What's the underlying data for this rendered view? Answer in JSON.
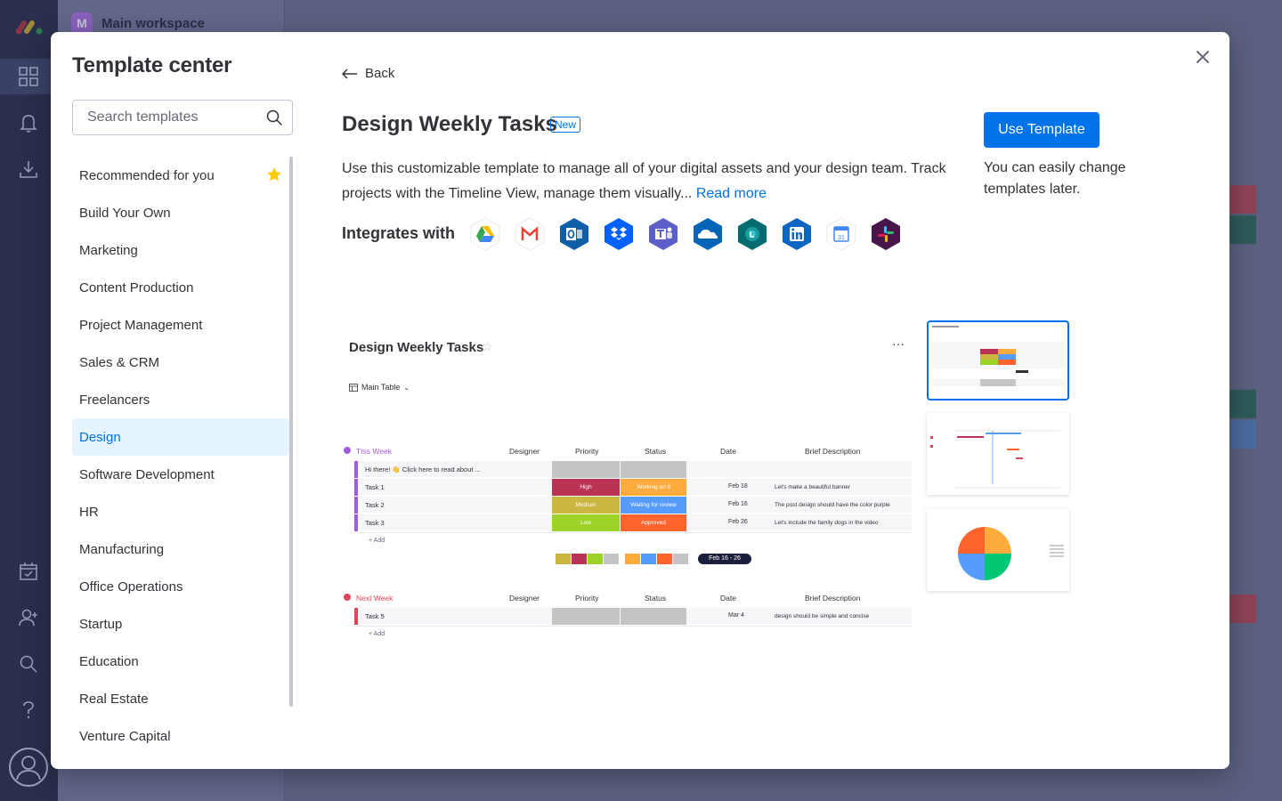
{
  "background": {
    "workspace_initial": "M",
    "workspace_name": "Main workspace"
  },
  "modal": {
    "title": "Template center",
    "search": {
      "placeholder": "Search templates"
    },
    "categories": [
      {
        "label": "Recommended for you",
        "starred": true
      },
      {
        "label": "Build Your Own"
      },
      {
        "label": "Marketing"
      },
      {
        "label": "Content Production"
      },
      {
        "label": "Project Management"
      },
      {
        "label": "Sales & CRM"
      },
      {
        "label": "Freelancers"
      },
      {
        "label": "Design",
        "active": true
      },
      {
        "label": "Software Development"
      },
      {
        "label": "HR"
      },
      {
        "label": "Manufacturing"
      },
      {
        "label": "Office Operations"
      },
      {
        "label": "Startup"
      },
      {
        "label": "Education"
      },
      {
        "label": "Real Estate"
      },
      {
        "label": "Venture Capital"
      }
    ]
  },
  "template": {
    "back_label": "Back",
    "title": "Design Weekly Tasks",
    "badge": "New",
    "description": "Use this customizable template to manage all of your digital assets and your design team. Track projects with the Timeline View, manage them visually...",
    "read_more": "Read more",
    "integrates_label": "Integrates with",
    "integrations": [
      "google-drive-icon",
      "gmail-icon",
      "outlook-icon",
      "dropbox-icon",
      "teams-icon",
      "onedrive-icon",
      "sharepoint-icon",
      "linkedin-icon",
      "google-calendar-icon",
      "slack-icon"
    ],
    "use_button": "Use Template",
    "change_note": "You can easily change templates later."
  },
  "preview": {
    "board_title": "Design Weekly Tasks",
    "table_tab": "Main Table",
    "columns": {
      "designer": "Designer",
      "priority": "Priority",
      "status": "Status",
      "date": "Date",
      "brief": "Brief Description"
    },
    "groups": [
      {
        "name": "This Week",
        "color": "#a25ddc",
        "rows": [
          {
            "item": "Hi there! 👋 Click here to read about ...",
            "priority": "",
            "status": "",
            "date": "",
            "brief": ""
          },
          {
            "item": "Task 1",
            "priority": "High",
            "status": "Working on it",
            "date": "Feb 18",
            "brief": "Let's make a beautiful banner"
          },
          {
            "item": "Task 2",
            "priority": "Medium",
            "status": "Waiting for review",
            "date": "Feb 16",
            "brief": "The post design should have the color purple"
          },
          {
            "item": "Task 3",
            "priority": "Low",
            "status": "Approved",
            "date": "Feb 26",
            "brief": "Let's include the family dogs in the video"
          }
        ],
        "add_label": "+ Add",
        "timeline_summary": "Feb 16 - 26"
      },
      {
        "name": "Next Week",
        "color": "#e2445c",
        "rows": [
          {
            "item": "Task 5",
            "priority": "",
            "status": "",
            "date": "Mar 4",
            "brief": "design should be simple and concise"
          }
        ],
        "add_label": "+ Add"
      }
    ],
    "colors": {
      "high": "#bb3354",
      "medium": "#cab641",
      "low": "#9cd326",
      "working": "#fdab3d",
      "review": "#579bfc",
      "approved": "#ff642e",
      "empty": "#c4c4c4"
    }
  }
}
